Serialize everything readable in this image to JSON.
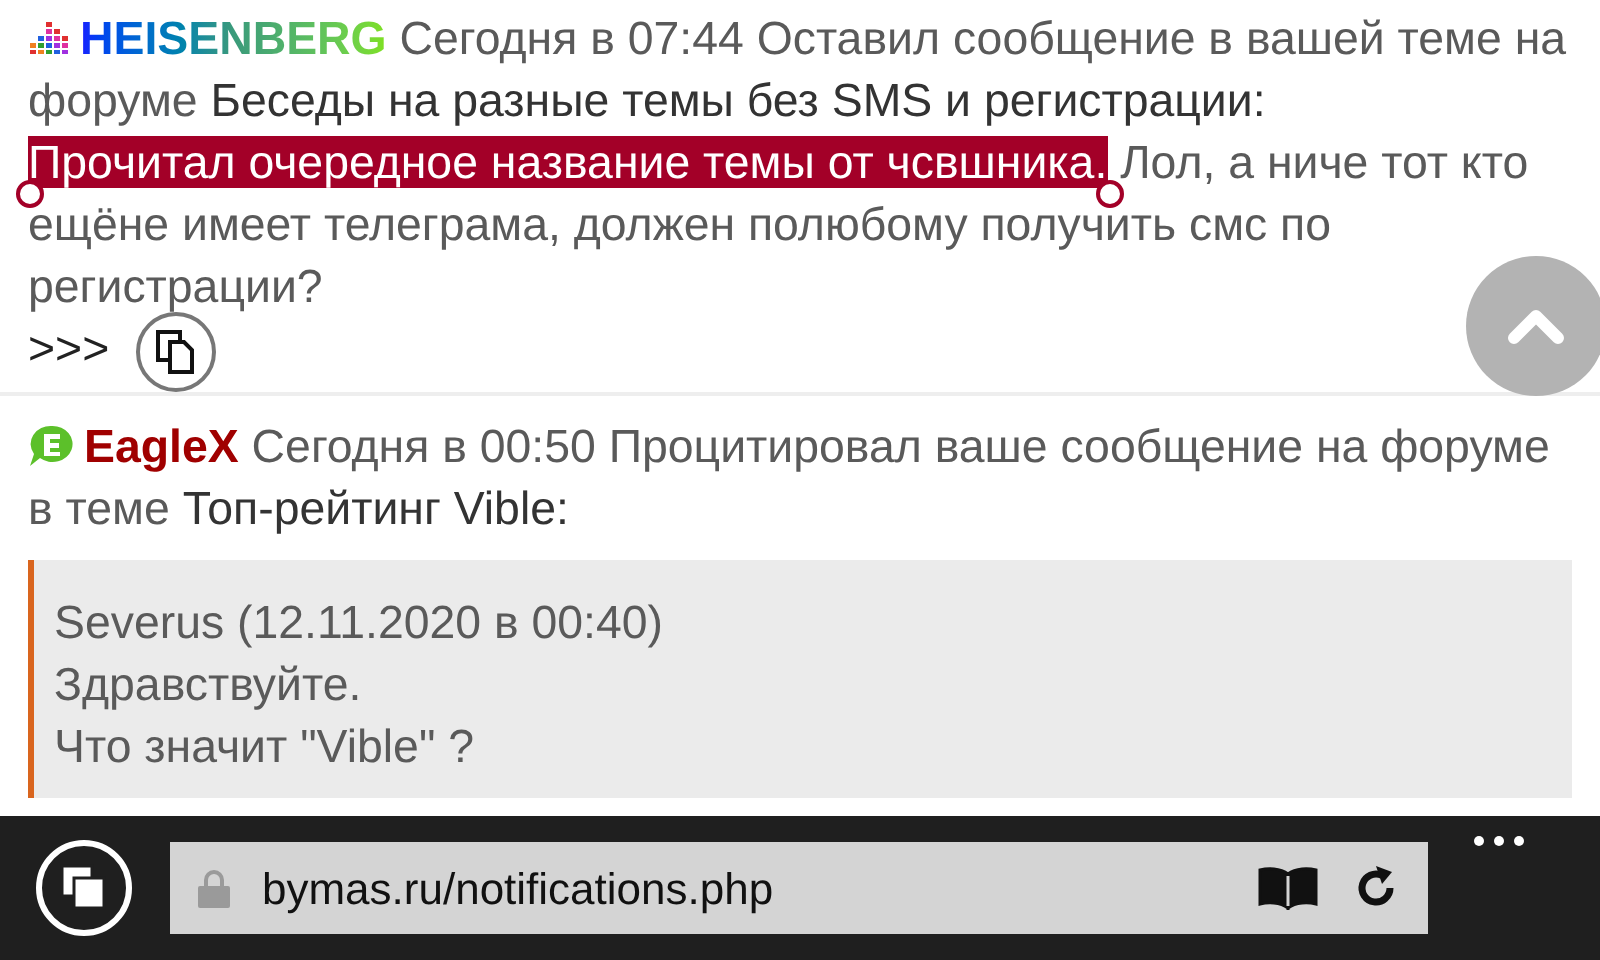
{
  "notifications": [
    {
      "user": {
        "name": "HEISENBERG"
      },
      "meta": "Сегодня в 07:44 Оставил сообщение в вашей теме на форуме",
      "topic": "Беседы на разные темы без SMS и регистрации:",
      "message": [
        {
          "text": "Прочитал очередное название темы от чсвшника.",
          "selected": true
        },
        {
          "text": "Лол, а ниче тот кто ещёне имеет телеграма, должен полюбому получить смс по регистрации?",
          "selected": false
        }
      ],
      "more": ">>>"
    },
    {
      "user": {
        "name": "EagleX"
      },
      "meta": "Сегодня в 00:50 Процитировал ваше сообщение на форуме в теме",
      "topic": "Топ-рейтинг Vible:",
      "quote": [
        "Severus (12.11.2020 в 00:40)",
        "Здравствуйте.",
        "Что значит \"Vible\" ?"
      ]
    }
  ],
  "address_bar": {
    "url": "bymas.ru/notifications.php"
  }
}
